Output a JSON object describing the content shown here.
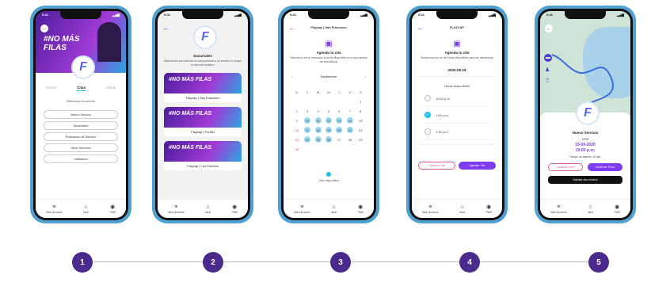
{
  "status_bar": {
    "time": "9:41",
    "signal": "▂▄▆"
  },
  "nav": {
    "menu_label": "Más Opciones",
    "home_label": "Inicio",
    "profile_label": "Perfil"
  },
  "screen1": {
    "banner_text": "#NO MÁS FILAS",
    "tabs": [
      "Turnos",
      "Citas",
      "Virtual"
    ],
    "section_label": "Seleccione un servicio",
    "buttons": [
      "Nuevo Servicio",
      "Sucursales",
      "Evaluación de Servicio",
      "Otros Servicios",
      "Validación"
    ]
  },
  "screen2": {
    "title": "Sucursales",
    "subtitle": "Seleccione una sucursal, la cual ponemos a su servicio en la que le sea más práctico",
    "banner_text": "#NO MÁS FILAS",
    "branches": [
      "Flayzap | San Francisco",
      "Flayzap | Portillo",
      "Flayzap | Los Puentes"
    ]
  },
  "screen3": {
    "title": "Flayzap | San Francisco",
    "heading": "Agenda tu cita",
    "sub": "Selecciona en el calendario la fecha disponible en la que deseas ser atendido(a)",
    "month": "Septiembre",
    "weekdays": [
      "D",
      "L",
      "M",
      "M",
      "J",
      "V",
      "S"
    ],
    "weeks": [
      [
        "",
        "",
        "",
        "",
        "",
        "",
        "1"
      ],
      [
        "2",
        "3",
        "4",
        "5",
        "6",
        "7",
        "8"
      ],
      [
        "9",
        "10",
        "11",
        "12",
        "13",
        "14",
        "15"
      ],
      [
        "16",
        "17",
        "18",
        "19",
        "20",
        "21",
        "22"
      ],
      [
        "23",
        "24",
        "25",
        "26",
        "27",
        "28",
        "29"
      ],
      [
        "30",
        "",
        "",
        "",
        "",
        "",
        ""
      ]
    ],
    "legend": "Citas disponibles"
  },
  "screen4": {
    "title": "FLAYZAP",
    "heading": "Agenda tu cita",
    "sub": "Selecciona uno de las horas disponibles para ser atendido(a)",
    "date": "2020-09-19",
    "hours_label": "Horas disponibles",
    "hours": [
      "12:00 p.m.",
      "1:00 p.m.",
      "1:30 p.m."
    ],
    "selected_hour": "1:00 p.m.",
    "cancel_label": "Cancelar Cita",
    "confirm_label": "Agendar Cita"
  },
  "screen5": {
    "service": "Nuevo Servicio",
    "kind": "CITA",
    "date": "19-09-2020",
    "time": "10:00 p.m.",
    "wait": "Tiempo de espera: 15 min.",
    "cancel_label": "Cancelar Turno",
    "confirm_label": "Confirmar Turno",
    "alt_label": "Solicitar otro servicio"
  },
  "steps": [
    "1",
    "2",
    "3",
    "4",
    "5"
  ],
  "colors": {
    "accent": "#7d3cf0",
    "brand_blue": "#1ec0f0",
    "frame": "#4f9fd0",
    "step": "#4a2a8c"
  }
}
